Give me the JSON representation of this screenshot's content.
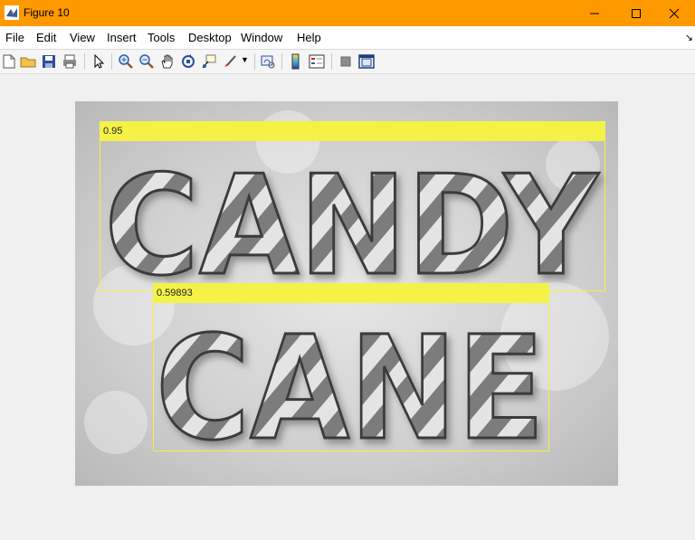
{
  "window": {
    "title": "Figure 10",
    "title_bar_color": "#ff9900",
    "app_icon": "matlab-icon",
    "controls": [
      "minimize-icon",
      "maximize-icon",
      "close-icon"
    ]
  },
  "menu": {
    "items": [
      "File",
      "Edit",
      "View",
      "Insert",
      "Tools",
      "Desktop",
      "Window",
      "Help"
    ]
  },
  "toolbar": {
    "buttons": [
      "new-figure-icon",
      "open-file-icon",
      "save-icon",
      "print-icon",
      "pointer-icon",
      "zoom-in-icon",
      "zoom-out-icon",
      "pan-icon",
      "rotate-3d-icon",
      "data-cursor-icon",
      "brush-icon",
      "link-plot-icon",
      "colorbar-icon",
      "legend-icon",
      "hide-plot-tools-icon",
      "show-plot-tools-icon"
    ]
  },
  "figure": {
    "image_words": [
      "CANDY",
      "CANE"
    ],
    "detections": [
      {
        "score": "0.95"
      },
      {
        "score": "0.59893"
      }
    ],
    "box_color": "#f4f046"
  }
}
